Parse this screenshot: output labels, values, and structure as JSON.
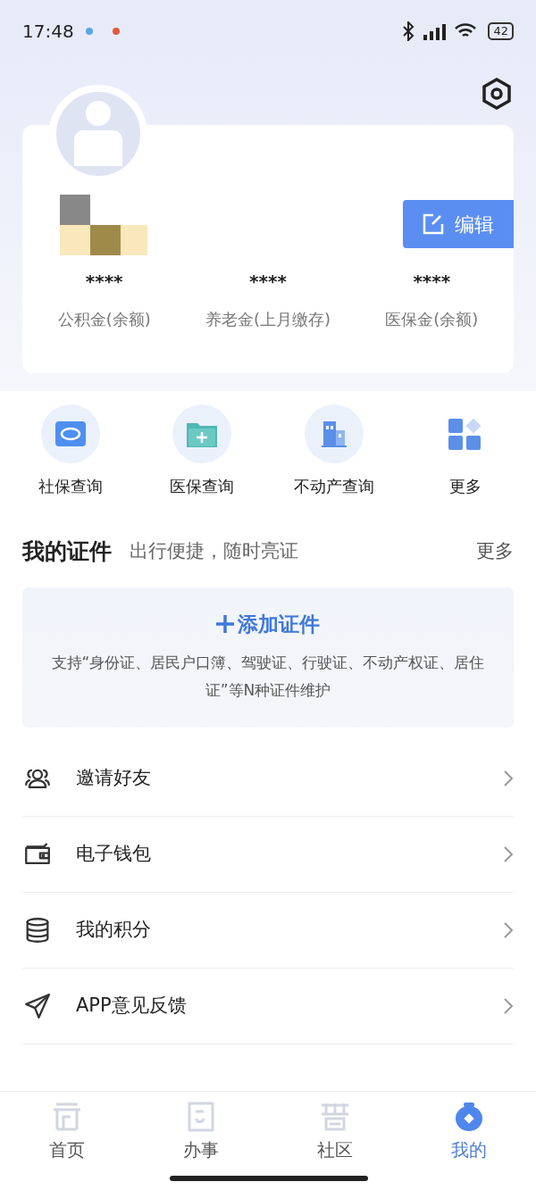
{
  "status_bar": {
    "time": "17:48",
    "battery": "42"
  },
  "profile": {
    "edit_button": "编辑",
    "stats": [
      {
        "value": "****",
        "label": "公积金(余额)"
      },
      {
        "value": "****",
        "label": "养老金(上月缴存)"
      },
      {
        "value": "****",
        "label": "医保金(余额)"
      }
    ]
  },
  "shortcuts": [
    {
      "kind": "social",
      "label": "社保查询"
    },
    {
      "kind": "medical",
      "label": "医保查询"
    },
    {
      "kind": "property",
      "label": "不动产查询"
    },
    {
      "kind": "more",
      "label": "更多"
    }
  ],
  "certificates": {
    "title": "我的证件",
    "subtitle": "出行便捷，随时亮证",
    "more": "更多",
    "add_button": "添加证件",
    "description": "支持“身份证、居民户口簿、驾驶证、行驶证、不动产权证、居住证”等N种证件维护"
  },
  "menu": [
    {
      "kind": "invite",
      "label": "邀请好友"
    },
    {
      "kind": "wallet",
      "label": "电子钱包"
    },
    {
      "kind": "points",
      "label": "我的积分"
    },
    {
      "kind": "feedback",
      "label": "APP意见反馈"
    }
  ],
  "tab_bar": [
    {
      "kind": "home",
      "label": "首页",
      "selected": false
    },
    {
      "kind": "services",
      "label": "办事",
      "selected": false
    },
    {
      "kind": "community",
      "label": "社区",
      "selected": false
    },
    {
      "kind": "mine",
      "label": "我的",
      "selected": true
    }
  ]
}
